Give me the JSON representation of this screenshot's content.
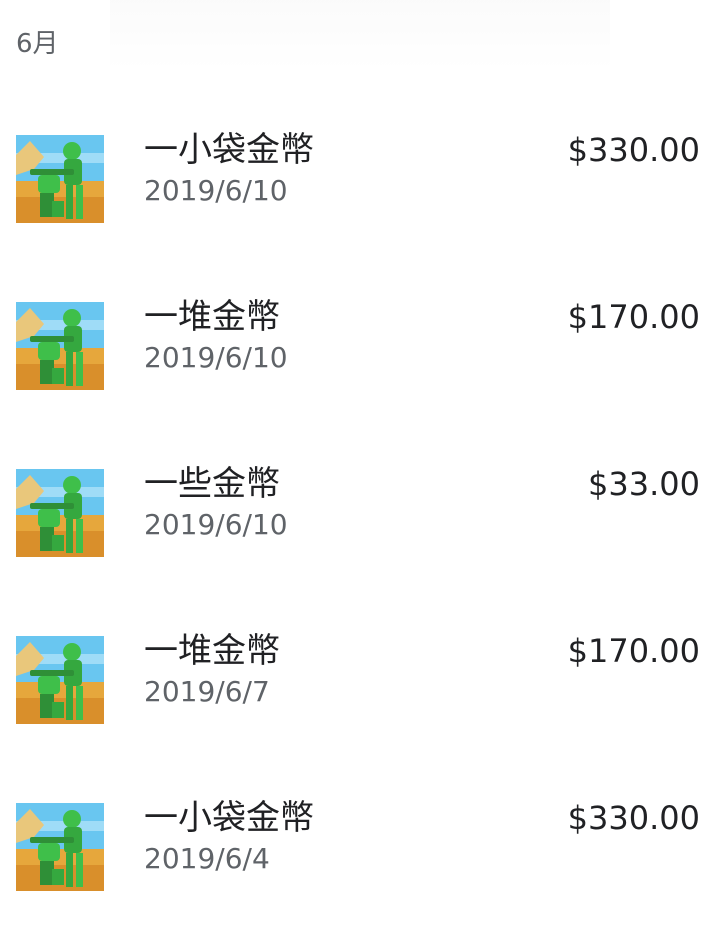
{
  "section": {
    "month_label": "6月"
  },
  "purchases": [
    {
      "title": "一小袋金幣",
      "date": "2019/6/10",
      "price": "$330.00",
      "icon": "army-men-game-icon"
    },
    {
      "title": "一堆金幣",
      "date": "2019/6/10",
      "price": "$170.00",
      "icon": "army-men-game-icon"
    },
    {
      "title": "一些金幣",
      "date": "2019/6/10",
      "price": "$33.00",
      "icon": "army-men-game-icon"
    },
    {
      "title": "一堆金幣",
      "date": "2019/6/7",
      "price": "$170.00",
      "icon": "army-men-game-icon"
    },
    {
      "title": "一小袋金幣",
      "date": "2019/6/4",
      "price": "$330.00",
      "icon": "army-men-game-icon"
    }
  ],
  "colors": {
    "title": "#202124",
    "secondary": "#5f6368",
    "sky": "#69c6f0",
    "sand": "#e6a73c",
    "soldier": "#3fbf4a"
  }
}
